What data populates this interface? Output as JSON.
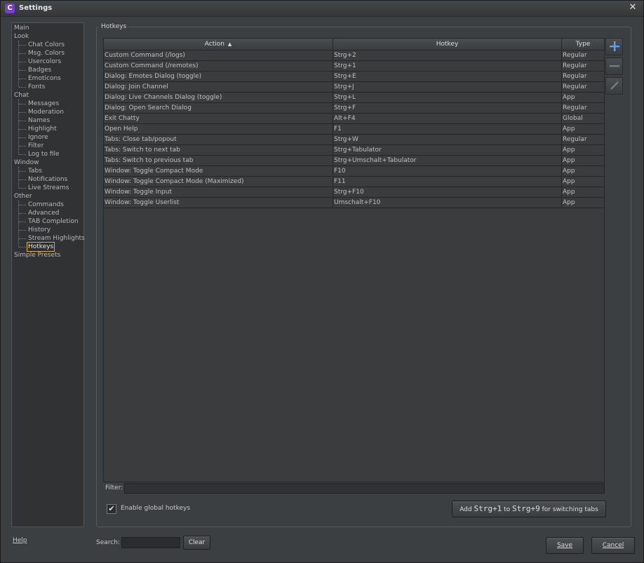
{
  "window": {
    "title": "Settings",
    "app_icon_letter": "C",
    "close_glyph": "✕"
  },
  "nav": {
    "roots": [
      {
        "label": "Main"
      },
      {
        "label": "Look",
        "children": [
          "Chat Colors",
          "Msg. Colors",
          "Usercolors",
          "Badges",
          "Emoticons",
          "Fonts"
        ]
      },
      {
        "label": "Chat",
        "children": [
          "Messages",
          "Moderation",
          "Names",
          "Highlight",
          "Ignore",
          "Filter",
          "Log to file"
        ]
      },
      {
        "label": "Window",
        "children": [
          "Tabs",
          "Notifications",
          "Live Streams"
        ]
      },
      {
        "label": "Other",
        "children": [
          "Commands",
          "Advanced",
          "TAB Completion",
          "History",
          "Stream Highlights",
          "Hotkeys"
        ]
      },
      {
        "label": "Simple Presets"
      }
    ],
    "selected": "Hotkeys"
  },
  "hotkeys": {
    "group_title": "Hotkeys",
    "columns": {
      "action": "Action",
      "sort_glyph": "▲",
      "hotkey": "Hotkey",
      "type": "Type"
    },
    "rows": [
      [
        "Custom Command (/logs)",
        "Strg+2",
        "Regular"
      ],
      [
        "Custom Command (/remotes)",
        "Strg+1",
        "Regular"
      ],
      [
        "Dialog: Emotes Dialog (toggle)",
        "Strg+E",
        "Regular"
      ],
      [
        "Dialog: Join Channel",
        "Strg+J",
        "Regular"
      ],
      [
        "Dialog: Live Channels Dialog (toggle)",
        "Strg+L",
        "App"
      ],
      [
        "Dialog: Open Search Dialog",
        "Strg+F",
        "Regular"
      ],
      [
        "Exit Chatty",
        "Alt+F4",
        "Global"
      ],
      [
        "Open Help",
        "F1",
        "App"
      ],
      [
        "Tabs: Close tab/popout",
        "Strg+W",
        "Regular"
      ],
      [
        "Tabs: Switch to next tab",
        "Strg+Tabulator",
        "App"
      ],
      [
        "Tabs: Switch to previous tab",
        "Strg+Umschalt+Tabulator",
        "App"
      ],
      [
        "Window: Toggle Compact Mode",
        "F10",
        "App"
      ],
      [
        "Window: Toggle Compact Mode (Maximized)",
        "F11",
        "App"
      ],
      [
        "Window: Toggle Input",
        "Strg+F10",
        "App"
      ],
      [
        "Window: Toggle Userlist",
        "Umschalt+F10",
        "App"
      ]
    ],
    "filter_label": "Filter:",
    "filter_value": "",
    "enable_global_label": "Enable global hotkeys",
    "enable_global_checked": true,
    "add_tabs_button": {
      "prefix": "Add ",
      "key1": "Strg+1",
      "mid": " to ",
      "key2": "Strg+9",
      "suffix": " for switching tabs"
    },
    "icons": {
      "add": "plus-icon",
      "remove": "minus-icon",
      "edit": "pencil-icon"
    },
    "add_color": "#5aa0ff"
  },
  "footer": {
    "help_label": "Help",
    "search_label": "Search:",
    "search_value": "",
    "clear_label": "Clear",
    "save_label": "Save",
    "cancel_label": "Cancel"
  }
}
